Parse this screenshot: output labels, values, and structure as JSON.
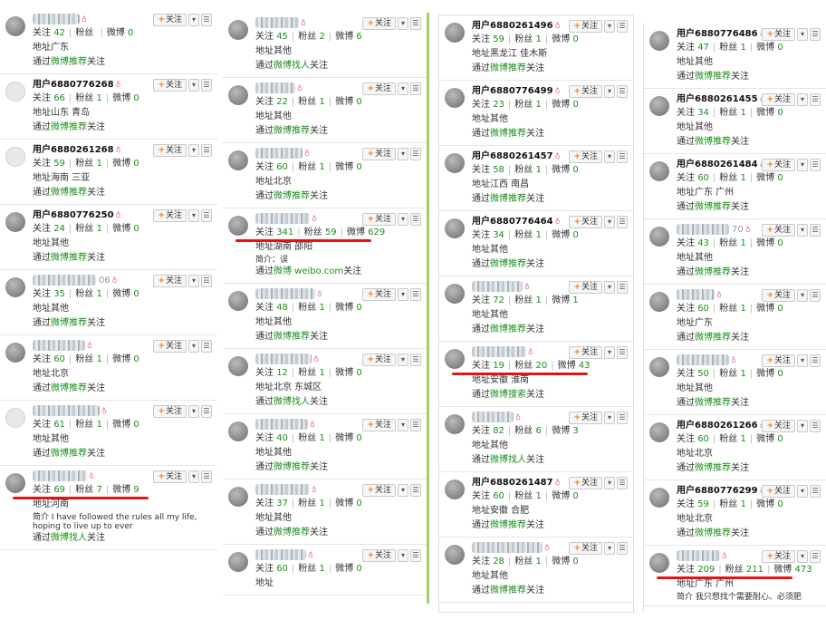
{
  "common": {
    "follow_label": "关注",
    "plus": "+",
    "dropdown_icon": "▾",
    "menu_icon": "☰",
    "v_badge": "♁",
    "following_label": "关注",
    "fans_label": "粉丝",
    "weibo_label": "微博",
    "address_label": "地址",
    "via_prefix": "通过",
    "via_suffix": "关注"
  },
  "columns": [
    {
      "cards": [
        {
          "name": "",
          "following": "42",
          "fans": "",
          "weibo": "0",
          "address": "广东",
          "via": "微博推荐"
        },
        {
          "name": "用户6880776268",
          "following": "66",
          "fans": "1",
          "weibo": "0",
          "address": "山东 青岛",
          "via": "微博推荐"
        },
        {
          "name": "用户6880261268",
          "following": "59",
          "fans": "1",
          "weibo": "0",
          "address": "海南 三亚",
          "via": "微博推荐"
        },
        {
          "name": "用户6880776250",
          "following": "24",
          "fans": "1",
          "weibo": "0",
          "address": "其他",
          "via": "微博推荐"
        },
        {
          "name": "",
          "tail": "06",
          "following": "35",
          "fans": "1",
          "weibo": "0",
          "address": "其他",
          "via": "微博推荐"
        },
        {
          "name": "",
          "following": "60",
          "fans": "1",
          "weibo": "0",
          "address": "北京",
          "via": "微博推荐"
        },
        {
          "name": "",
          "following": "61",
          "fans": "1",
          "weibo": "0",
          "address": "其他",
          "via": "微博推荐"
        },
        {
          "name": "",
          "following": "69",
          "fans": "7",
          "weibo": "9",
          "address": "河南",
          "bio": "简介 I have followed the rules all my life, hoping to live up to ever",
          "via": "微博找人"
        }
      ]
    },
    {
      "cards": [
        {
          "name": "",
          "following": "45",
          "fans": "2",
          "weibo": "6",
          "address": "其他",
          "via": "微博找人"
        },
        {
          "name": "",
          "following": "22",
          "fans": "1",
          "weibo": "0",
          "address": "其他",
          "via": "微博推荐"
        },
        {
          "name": "",
          "following": "60",
          "fans": "1",
          "weibo": "0",
          "address": "北京",
          "via": "微博推荐"
        },
        {
          "name": "",
          "following": "341",
          "fans": "59",
          "weibo": "629",
          "address": "湖南 邵阳",
          "bio": "简介：误",
          "via": "微博 weibo.com"
        },
        {
          "name": "",
          "following": "48",
          "fans": "1",
          "weibo": "0",
          "address": "其他",
          "via": "微博推荐"
        },
        {
          "name": "",
          "following": "12",
          "fans": "1",
          "weibo": "0",
          "address": "北京 东城区",
          "via": "微博找人"
        },
        {
          "name": "",
          "following": "40",
          "fans": "1",
          "weibo": "0",
          "address": "其他",
          "via": "微博推荐"
        },
        {
          "name": "",
          "following": "37",
          "fans": "1",
          "weibo": "0",
          "address": "其他",
          "via": "微博推荐"
        },
        {
          "name": "",
          "following": "60",
          "fans": "1",
          "weibo": "0",
          "address": "",
          "via": ""
        }
      ]
    },
    {
      "cards": [
        {
          "name": "用户6880261496",
          "following": "59",
          "fans": "1",
          "weibo": "0",
          "address": "黑龙江 佳木斯",
          "via": "微博推荐"
        },
        {
          "name": "用户6880776499",
          "following": "23",
          "fans": "1",
          "weibo": "0",
          "address": "其他",
          "via": "微博推荐"
        },
        {
          "name": "用户6880261457",
          "following": "58",
          "fans": "1",
          "weibo": "0",
          "address": "江西 南昌",
          "via": "微博推荐"
        },
        {
          "name": "用户6880776464",
          "following": "34",
          "fans": "1",
          "weibo": "0",
          "address": "其他",
          "via": "微博推荐"
        },
        {
          "name": "",
          "following": "72",
          "fans": "1",
          "weibo": "1",
          "address": "其他",
          "via": "微博推荐"
        },
        {
          "name": "",
          "following": "19",
          "fans": "20",
          "weibo": "43",
          "address": "安徽 淮南",
          "via": "微博搜索"
        },
        {
          "name": "",
          "following": "82",
          "fans": "6",
          "weibo": "3",
          "address": "其他",
          "via": "微博找人"
        },
        {
          "name": "用户6880261487",
          "following": "60",
          "fans": "1",
          "weibo": "0",
          "address": "安徽 合肥",
          "via": "微博推荐"
        },
        {
          "name": "",
          "following": "28",
          "fans": "1",
          "weibo": "0",
          "address": "其他",
          "via": "微博推荐"
        }
      ]
    },
    {
      "cards": [
        {
          "name": "用户6880776486",
          "following": "47",
          "fans": "1",
          "weibo": "0",
          "address": "其他",
          "via": "微博推荐"
        },
        {
          "name": "用户6880261455",
          "following": "34",
          "fans": "1",
          "weibo": "0",
          "address": "其他",
          "via": "微博推荐"
        },
        {
          "name": "用户6880261484",
          "following": "60",
          "fans": "1",
          "weibo": "0",
          "address": "广东 广州",
          "via": "微博推荐"
        },
        {
          "name": "",
          "tail": "70",
          "following": "43",
          "fans": "1",
          "weibo": "0",
          "address": "其他",
          "via": "微博推荐"
        },
        {
          "name": "",
          "following": "60",
          "fans": "1",
          "weibo": "0",
          "address": "广东",
          "via": "微博推荐"
        },
        {
          "name": "",
          "following": "50",
          "fans": "1",
          "weibo": "0",
          "address": "其他",
          "via": "微博推荐"
        },
        {
          "name": "用户6880261266",
          "following": "60",
          "fans": "1",
          "weibo": "0",
          "address": "北京",
          "via": "微博推荐"
        },
        {
          "name": "用户6880776299",
          "following": "59",
          "fans": "1",
          "weibo": "0",
          "address": "北京",
          "via": "微博推荐"
        },
        {
          "name": "",
          "following": "209",
          "fans": "211",
          "weibo": "473",
          "address": "广东 广州",
          "bio": "简介 我只想找个需要耐心、必须肥",
          "via": ""
        }
      ]
    }
  ],
  "highlights": [
    {
      "column": 0,
      "card": 7
    },
    {
      "column": 1,
      "card": 3
    },
    {
      "column": 2,
      "card": 5
    },
    {
      "column": 3,
      "card": 8
    }
  ]
}
